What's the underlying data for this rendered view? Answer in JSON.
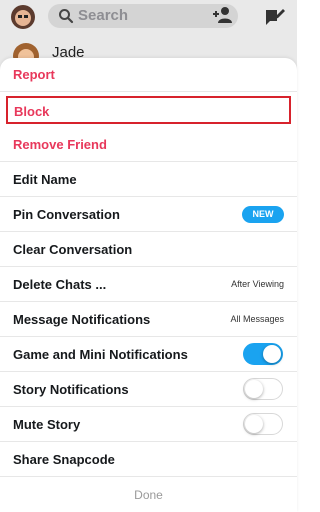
{
  "header": {
    "search_placeholder": "Search"
  },
  "conversation_peek": {
    "name": "Jade"
  },
  "menu": {
    "items": [
      {
        "label": "Report",
        "style": "red"
      },
      {
        "label": "Block",
        "style": "red",
        "highlighted": true
      },
      {
        "label": "Remove Friend",
        "style": "red"
      },
      {
        "label": "Edit Name"
      },
      {
        "label": "Pin Conversation",
        "badge": "NEW"
      },
      {
        "label": "Clear Conversation"
      },
      {
        "label": "Delete Chats ...",
        "value": "After Viewing"
      },
      {
        "label": "Message Notifications",
        "value": "All Messages"
      },
      {
        "label": "Game and Mini Notifications",
        "toggle": true
      },
      {
        "label": "Story Notifications",
        "toggle": false
      },
      {
        "label": "Mute Story",
        "toggle": false
      },
      {
        "label": "Share Snapcode"
      }
    ],
    "done_label": "Done"
  },
  "colors": {
    "danger": "#e8385b",
    "accent": "#1aa3f0",
    "highlight_border": "#d7222c"
  },
  "icons": {
    "avatar": "bitmoji-avatar-icon",
    "search": "search-icon",
    "add_friend": "add-friend-icon",
    "new_chat": "new-chat-icon"
  }
}
